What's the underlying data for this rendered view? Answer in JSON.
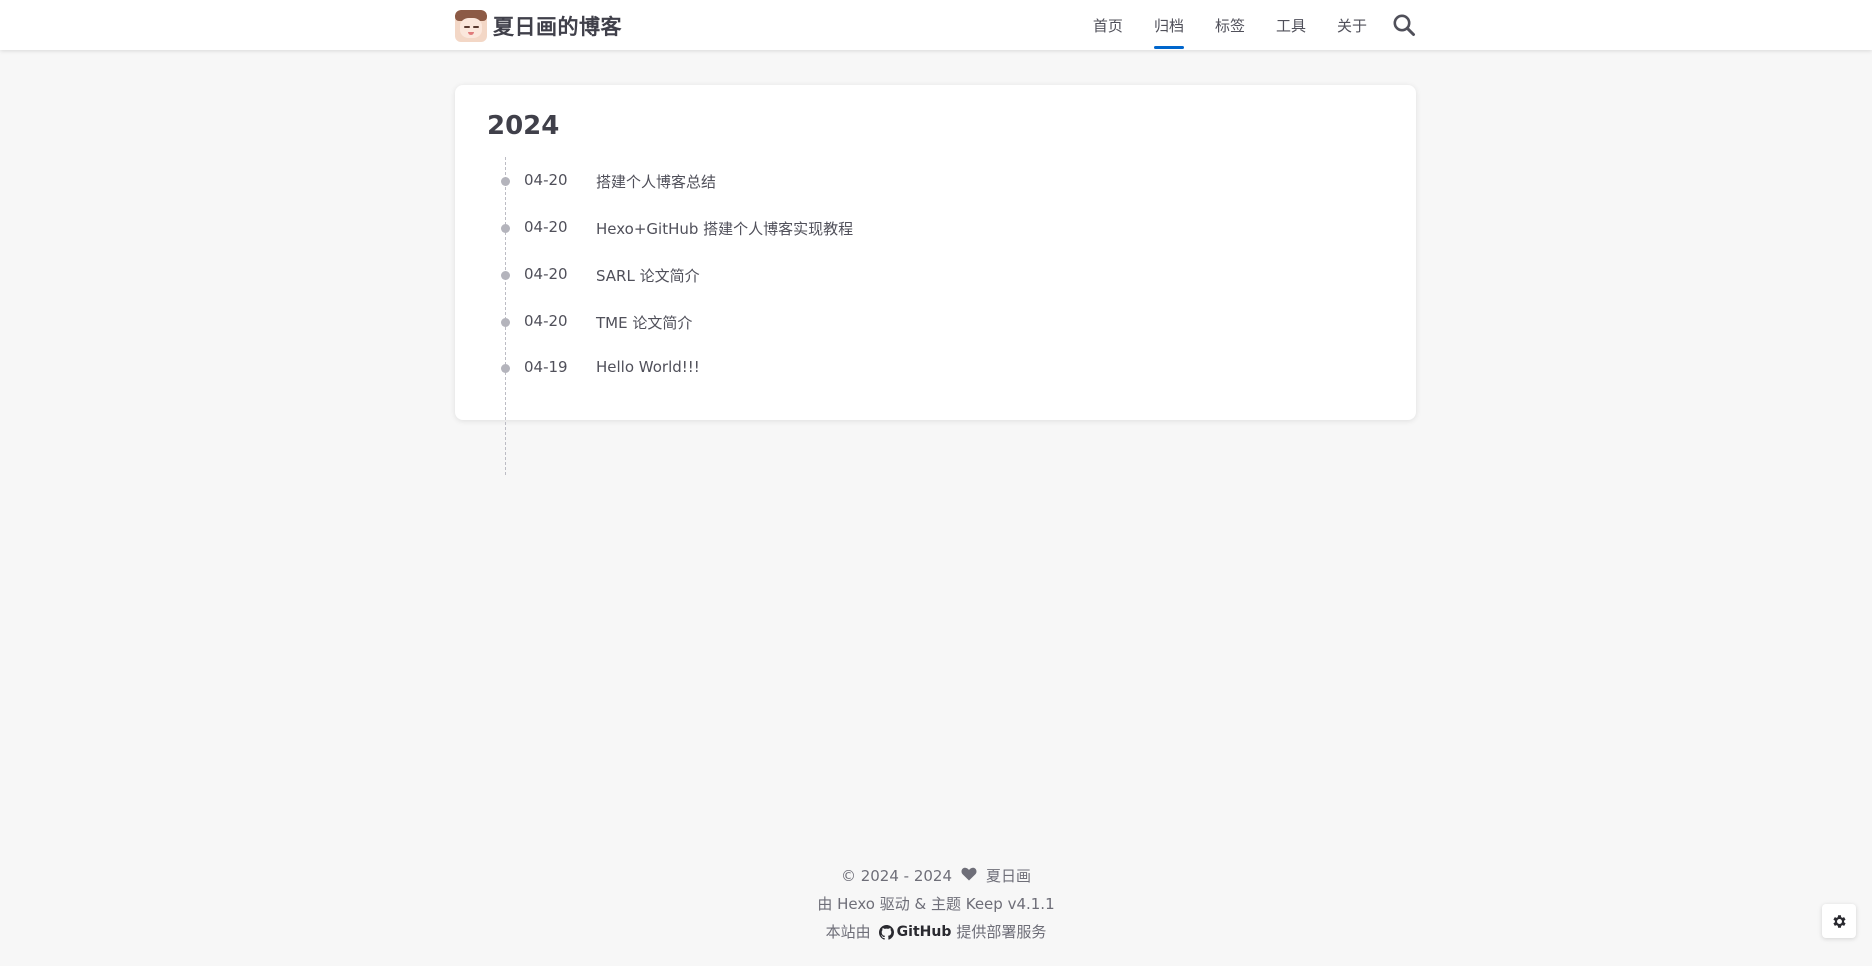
{
  "header": {
    "site_title": "夏日画的博客",
    "logo_icon": "avatar-logo",
    "nav": [
      {
        "label": "首页",
        "active": false
      },
      {
        "label": "归档",
        "active": true
      },
      {
        "label": "标签",
        "active": false
      },
      {
        "label": "工具",
        "active": false
      },
      {
        "label": "关于",
        "active": false
      }
    ],
    "search_icon": "search-icon",
    "accent_color": "#0066cc"
  },
  "archive": {
    "year": "2024",
    "posts": [
      {
        "date": "04-20",
        "title": "搭建个人博客总结"
      },
      {
        "date": "04-20",
        "title": "Hexo+GitHub 搭建个人博客实现教程"
      },
      {
        "date": "04-20",
        "title": "SARL 论文简介"
      },
      {
        "date": "04-20",
        "title": "TME 论文简介"
      },
      {
        "date": "04-19",
        "title": "Hello World!!!"
      }
    ]
  },
  "footer": {
    "copyright": "© 2024 - 2024",
    "author": "夏日画",
    "powered_by": "由 Hexo 驱动 & 主题 Keep v4.1.1",
    "hosted_prefix": "本站由",
    "hosted_brand": "GitHub",
    "hosted_suffix": "提供部署服务"
  },
  "settings_icon": "gear-icon"
}
